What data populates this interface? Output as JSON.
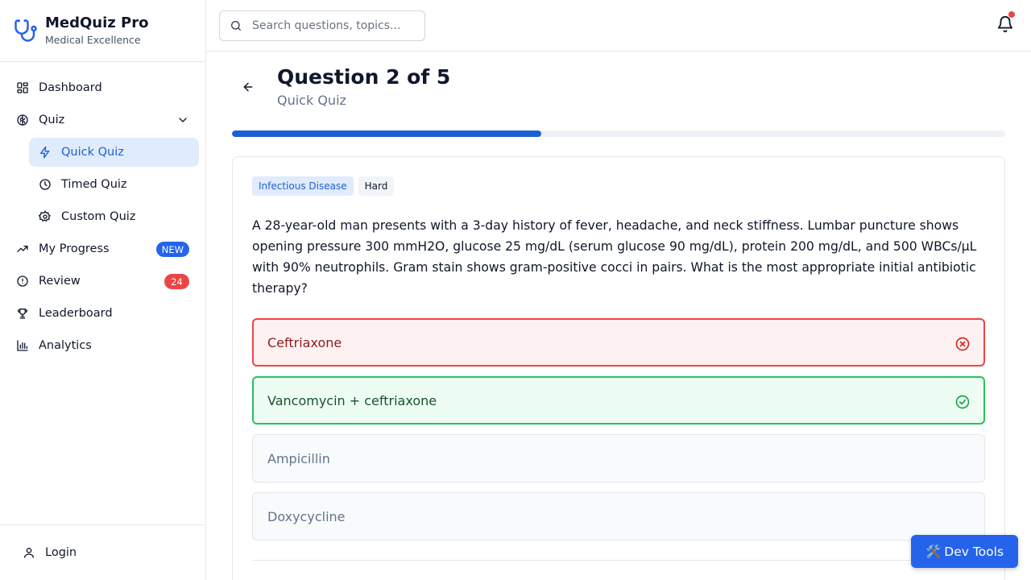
{
  "brand": {
    "title": "MedQuiz Pro",
    "subtitle": "Medical Excellence",
    "icon": "stethoscope-icon",
    "accent": "#2563eb"
  },
  "sidebar": {
    "items": [
      {
        "label": "Dashboard",
        "icon": "layout-grid-icon"
      },
      {
        "label": "Quiz",
        "icon": "brain-icon",
        "expanded": true
      },
      {
        "label": "Quick Quiz",
        "icon": "lightning-icon",
        "active": true
      },
      {
        "label": "Timed Quiz",
        "icon": "clock-icon"
      },
      {
        "label": "Custom Quiz",
        "icon": "gear-icon"
      },
      {
        "label": "My Progress",
        "icon": "trending-up-icon",
        "badge": "NEW"
      },
      {
        "label": "Review",
        "icon": "alert-circle-icon",
        "badge": "24"
      },
      {
        "label": "Leaderboard",
        "icon": "trophy-icon"
      },
      {
        "label": "Analytics",
        "icon": "bar-chart-icon"
      }
    ],
    "footer": {
      "label": "Login",
      "icon": "user-icon"
    }
  },
  "topbar": {
    "search_placeholder": "Search questions, topics...",
    "notification_icon": "bell-icon",
    "has_unread": true
  },
  "question": {
    "title": "Question 2 of 5",
    "subtitle": "Quick Quiz",
    "progress": 0.4,
    "tags": {
      "topic": "Infectious Disease",
      "difficulty": "Hard"
    },
    "stem": "A 28-year-old man presents with a 3-day history of fever, headache, and neck stiffness. Lumbar puncture shows opening pressure 300 mmH2O, glucose 25 mg/dL (serum glucose 90 mg/dL), protein 200 mg/dL, and 500 WBCs/µL with 90% neutrophils. Gram stain shows gram-positive cocci in pairs. What is the most appropriate initial antibiotic therapy?",
    "options": [
      {
        "label": "Ceftriaxone",
        "state": "incorrect"
      },
      {
        "label": "Vancomycin + ceftriaxone",
        "state": "correct"
      },
      {
        "label": "Ampicillin",
        "state": "neutral"
      },
      {
        "label": "Doxycycline",
        "state": "neutral"
      }
    ]
  },
  "devtools": {
    "label": "Dev Tools",
    "emoji": "🛠️"
  },
  "colors": {
    "correct": "#22c55e",
    "incorrect": "#ef4444",
    "primary": "#2563eb"
  }
}
